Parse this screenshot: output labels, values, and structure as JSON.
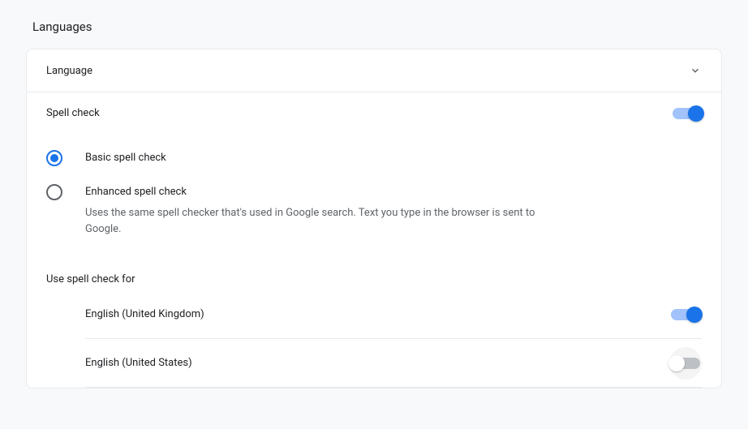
{
  "page": {
    "title": "Languages"
  },
  "collapsible": {
    "language_label": "Language"
  },
  "spellcheck": {
    "title": "Spell check",
    "enabled": true,
    "options": {
      "basic": {
        "label": "Basic spell check",
        "selected": true
      },
      "enhanced": {
        "label": "Enhanced spell check",
        "description": "Uses the same spell checker that's used in Google search. Text you type in the browser is sent to Google.",
        "selected": false
      }
    },
    "use_for_label": "Use spell check for",
    "languages": [
      {
        "name": "English (United Kingdom)",
        "enabled": true
      },
      {
        "name": "English (United States)",
        "enabled": false
      }
    ]
  }
}
